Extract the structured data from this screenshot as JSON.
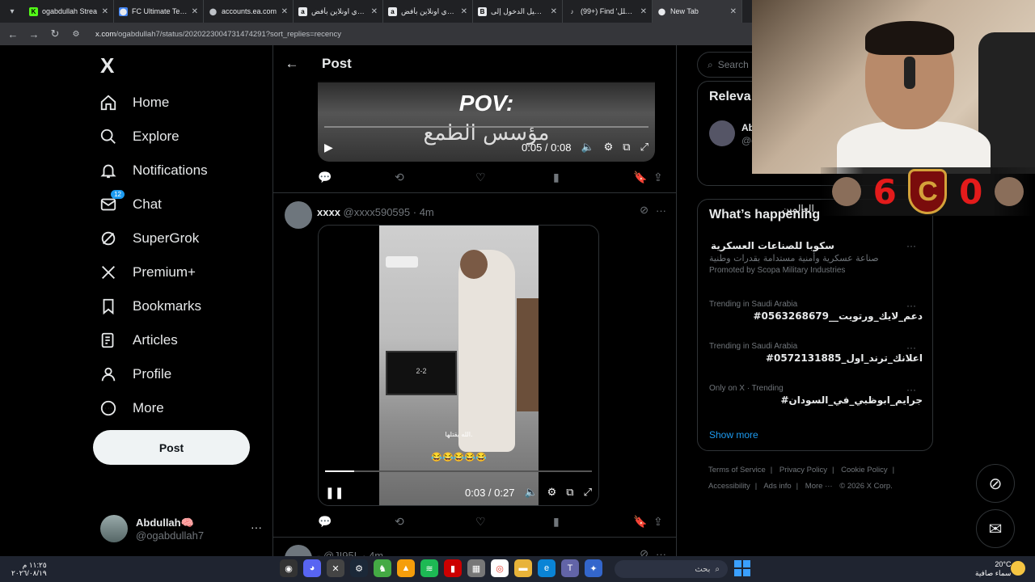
{
  "browser": {
    "tabs": [
      {
        "title": "ogabdullah Strea",
        "color": "#53fc18",
        "glyph": "K"
      },
      {
        "title": "FC Ultimate Team",
        "color": "#4285f4",
        "glyph": "⬤"
      },
      {
        "title": "accounts.ea.com",
        "color": "#bdc1c6",
        "glyph": "⬤"
      },
      {
        "title": "اشتري اونلاين بأفض",
        "color": "#e8eaed",
        "glyph": "a"
      },
      {
        "title": "اشتري اونلاين بأفض",
        "color": "#e8eaed",
        "glyph": "a"
      },
      {
        "title": "تسجيل الدخول إلى",
        "color": "#e8eaed",
        "glyph": "B"
      },
      {
        "title": "(99+) Find 'الشلل'",
        "color": "#e8eaed",
        "glyph": "♪"
      },
      {
        "title": "New Tab",
        "color": "#e8eaed",
        "glyph": "⬤"
      }
    ],
    "url_domain": "x.com",
    "url_path": "/ogabdullah7/status/2020223004731474291?sort_replies=recency"
  },
  "sidebar": {
    "logo": "X",
    "items": [
      {
        "label": "Home",
        "icon": "home-icon"
      },
      {
        "label": "Explore",
        "icon": "search-icon"
      },
      {
        "label": "Notifications",
        "icon": "bell-icon"
      },
      {
        "label": "Chat",
        "icon": "mail-icon",
        "badge": "12"
      },
      {
        "label": "SuperGrok",
        "icon": "grok-icon"
      },
      {
        "label": "Premium+",
        "icon": "x-icon"
      },
      {
        "label": "Bookmarks",
        "icon": "bookmark-icon"
      },
      {
        "label": "Articles",
        "icon": "article-icon"
      },
      {
        "label": "Profile",
        "icon": "person-icon"
      },
      {
        "label": "More",
        "icon": "more-circle-icon"
      }
    ],
    "post_button": "Post",
    "account": {
      "name": "Abdullah🧠",
      "handle": "@ogabdullah7"
    }
  },
  "main": {
    "title": "Post",
    "video1": {
      "pov": "POV:",
      "arabic": "مؤسس الطمع",
      "time": "0:05 / 0:08"
    },
    "tweet2": {
      "name": "xxxx",
      "handle": "@xxxx590595",
      "time": "· 4m"
    },
    "video2": {
      "tv": "2-2",
      "sub1": "الله يقتلها.",
      "sub2": "😂😂😂😂😂",
      "time": "0:03 / 0:27",
      "progress": 0.11
    },
    "tweet3": {
      "name": "-",
      "handle": "@JI95L",
      "time": "· 4m"
    }
  },
  "right": {
    "search_placeholder": "Search",
    "relevant_title": "Releva",
    "relevant_user": {
      "name": "Ab",
      "handle": "@c"
    },
    "relevant_bio": "العالمين",
    "happening_title": "What’s happening",
    "promo": {
      "title": "سكوبا للصناعات العسكرية",
      "desc": "صناعة عسكرية وأمنية مستدامة بقدرات وطنية",
      "by": "Promoted by Scopa Military Industries"
    },
    "trends": [
      {
        "meta": "Trending in Saudi Arabia",
        "name": "#دعم_لايك_ورتويت__0563268679"
      },
      {
        "meta": "Trending in Saudi Arabia",
        "name": "#اعلانك_ترند_اول_0572131885"
      },
      {
        "meta": "Only on X · Trending",
        "name": "#جرايم_ابوظبي_في_السودان"
      }
    ],
    "show_more": "Show more",
    "footer": [
      "Terms of Service",
      "|",
      "Privacy Policy",
      "|",
      "Cookie Policy",
      "|",
      "Accessibility",
      "|",
      "Ads info",
      "|",
      "More ···",
      "© 2026 X Corp."
    ]
  },
  "overlay": {
    "score_left": "6",
    "score_right": "0",
    "badge": "C"
  },
  "taskbar": {
    "time": "١١:٢٥ م",
    "date": "٢٠٢٦/٠٨/١٩",
    "search": "بحث",
    "temp": "20°C",
    "weather": "سماء صافية"
  },
  "colors": {
    "accent": "#1d9bf0",
    "bg": "#000000",
    "muted": "#71767b",
    "score": "#e31b1b"
  }
}
